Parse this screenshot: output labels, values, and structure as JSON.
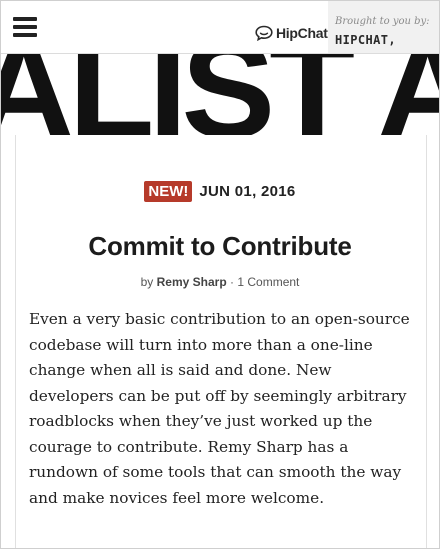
{
  "header": {
    "menu_icon": "hamburger-menu-icon",
    "sponsor_logo_text": "HipChat",
    "sponsor_logo_icon": "hipchat-logo-icon",
    "brought_by": "Brought to you by:",
    "sponsor_name": "HIPCHAT,"
  },
  "masthead": {
    "text": "ALIST A"
  },
  "post": {
    "badge": "NEW!",
    "date": "JUN 01, 2016",
    "title": "Commit to Contribute",
    "by_prefix": "by",
    "author": "Remy Sharp",
    "separator": "·",
    "comments": "1 Comment",
    "excerpt": "Even a very basic contribution to an open-source codebase will turn into more than a one-line change when all is said and done. New developers can be put off by seemingly arbitrary roadblocks when they’ve just worked up the courage to contribute. Remy Sharp has a rundown of some tools that can smooth the way and make novices feel more welcome."
  },
  "colors": {
    "badge_bg": "#b63a2a",
    "text": "#222222",
    "sponsor_panel": "#f1f1f1"
  }
}
